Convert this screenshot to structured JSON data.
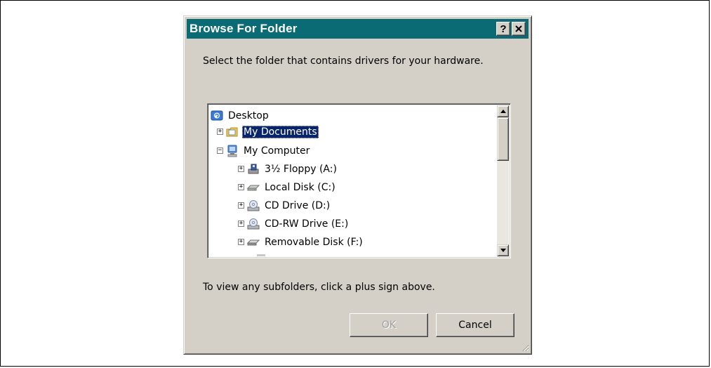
{
  "dialog": {
    "title": "Browse For Folder",
    "help_label": "?",
    "close_label": "✕",
    "prompt": "Select the folder that contains drivers for your hardware.",
    "hint": "To view any subfolders, click a plus sign above.",
    "ok_label": "OK",
    "cancel_label": "Cancel"
  },
  "tree": {
    "items": [
      {
        "label": "Desktop",
        "icon": "desktop-icon"
      },
      {
        "label": "My Documents",
        "icon": "my-documents-icon",
        "expander": "+",
        "selected": true
      },
      {
        "label": "My Computer",
        "icon": "my-computer-icon",
        "expander": "−"
      },
      {
        "label": "3½ Floppy (A:)",
        "icon": "floppy-drive-icon",
        "expander": "+"
      },
      {
        "label": "Local Disk (C:)",
        "icon": "hard-disk-icon",
        "expander": "+"
      },
      {
        "label": "CD Drive (D:)",
        "icon": "cd-drive-icon",
        "expander": "+"
      },
      {
        "label": "CD-RW Drive (E:)",
        "icon": "cd-rw-drive-icon",
        "expander": "+"
      },
      {
        "label": "Removable Disk (F:)",
        "icon": "removable-disk-icon",
        "expander": "+"
      }
    ]
  },
  "colors": {
    "titlebar": "#0a6b75",
    "selection": "#0a246a",
    "dialog_face": "#d4d0c8"
  }
}
